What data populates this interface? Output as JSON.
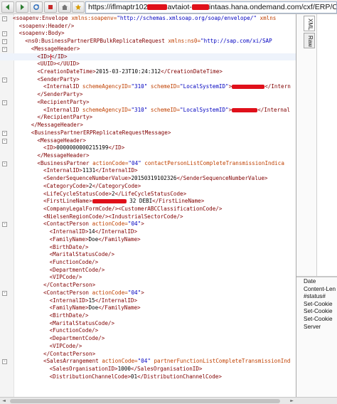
{
  "toolbar": {
    "back_label": "◄",
    "forward_label": "►",
    "url_parts": [
      "https://iflmaptr102",
      "avtaiot-",
      "intaas.hana.ondemand.com/cxf/ERP/COD/customers"
    ]
  },
  "xml_lines": [
    {
      "ind": 0,
      "tog": "-",
      "html": "<span class='tag'>&lt;soapenv:Envelope</span> <span class='aname'>xmlns:soapenv=</span><span class='aval'>\"http://schemas.xmlsoap.org/soap/envelope/\"</span> <span class='aname'>xmlns</span>"
    },
    {
      "ind": 1,
      "tog": "",
      "html": "<span class='tag'>&lt;soapenv:Header/&gt;</span>"
    },
    {
      "ind": 1,
      "tog": "-",
      "html": "<span class='tag'>&lt;soapenv:Body&gt;</span>"
    },
    {
      "ind": 2,
      "tog": "-",
      "html": "<span class='tag'>&lt;ns0:BusinessPartnerERPBulkReplicateRequest</span> <span class='aname'>xmlns:ns0=</span><span class='aval'>\"http://sap.com/xi/SAP</span>"
    },
    {
      "ind": 3,
      "tog": "-",
      "html": "<span class='tag'>&lt;MessageHeader&gt;</span>"
    },
    {
      "ind": 4,
      "tog": "",
      "html": "<span class='tag'>&lt;ID&gt;</span><span class='cursor'></span><span class='tag'>&lt;/ID&gt;</span>"
    },
    {
      "ind": 4,
      "tog": "",
      "html": "<span class='tag'>&lt;UUID&gt;&lt;/UUID&gt;</span>"
    },
    {
      "ind": 4,
      "tog": "",
      "html": "<span class='tag'>&lt;CreationDateTime&gt;</span><span class='txt'>2015-03-23T10:24:312</span><span class='tag'>&lt;/CreationDateTime&gt;</span>"
    },
    {
      "ind": 4,
      "tog": "-",
      "html": "<span class='tag'>&lt;SenderParty&gt;</span>"
    },
    {
      "ind": 5,
      "tog": "",
      "html": "<span class='tag'>&lt;InternalID</span> <span class='aname'>schemeAgencyID=</span><span class='aval'>\"310\"</span> <span class='aname'>schemeID=</span><span class='aval'>\"LocalSystemID\"</span><span class='tag'>&gt;</span><span class='redact' style='width:46px'></span><span class='tag'>&lt;/Intern</span>"
    },
    {
      "ind": 4,
      "tog": "",
      "html": "<span class='tag'>&lt;/SenderParty&gt;</span>"
    },
    {
      "ind": 4,
      "tog": "-",
      "html": "<span class='tag'>&lt;RecipientParty&gt;</span>"
    },
    {
      "ind": 5,
      "tog": "",
      "html": "<span class='tag'>&lt;InternalID</span> <span class='aname'>schemeAgencyID=</span><span class='aval'>\"310\"</span> <span class='aname'>schemeID=</span><span class='aval'>\"LocalSystemID\"</span><span class='tag'>&gt;</span><span class='redact' style='width:36px'></span><span class='tag'>&lt;/Internal</span>"
    },
    {
      "ind": 4,
      "tog": "",
      "html": "<span class='tag'>&lt;/RecipientParty&gt;</span>"
    },
    {
      "ind": 3,
      "tog": "",
      "html": "<span class='tag'>&lt;/MessageHeader&gt;</span>"
    },
    {
      "ind": 3,
      "tog": "-",
      "html": "<span class='tag'>&lt;BusinessPartnerERPReplicateRequestMessage&gt;</span>"
    },
    {
      "ind": 4,
      "tog": "-",
      "html": "<span class='tag'>&lt;MessageHeader&gt;</span>"
    },
    {
      "ind": 5,
      "tog": "",
      "html": "<span class='tag'>&lt;ID&gt;</span><span class='txt'>0000000000215199</span><span class='tag'>&lt;/ID&gt;</span>"
    },
    {
      "ind": 4,
      "tog": "",
      "html": "<span class='tag'>&lt;/MessageHeader&gt;</span>"
    },
    {
      "ind": 4,
      "tog": "-",
      "html": "<span class='tag'>&lt;BusinessPartner</span> <span class='aname'>actionCode=</span><span class='aval'>\"04\"</span> <span class='aname'>contactPersonListCompleteTransmissionIndica</span>"
    },
    {
      "ind": 5,
      "tog": "",
      "html": "<span class='tag'>&lt;InternalID&gt;</span><span class='txt'>1131</span><span class='tag'>&lt;/InternalID&gt;</span>"
    },
    {
      "ind": 5,
      "tog": "",
      "html": "<span class='tag'>&lt;SenderSequenceNumberValue&gt;</span><span class='txt'>20150319102326</span><span class='tag'>&lt;/SenderSequenceNumberValue&gt;</span>"
    },
    {
      "ind": 5,
      "tog": "",
      "html": "<span class='tag'>&lt;CategoryCode&gt;</span><span class='txt'>2</span><span class='tag'>&lt;/CategoryCode&gt;</span>"
    },
    {
      "ind": 5,
      "tog": "",
      "html": "<span class='tag'>&lt;LifeCycleStatusCode&gt;</span><span class='txt'>2</span><span class='tag'>&lt;/LifeCycleStatusCode&gt;</span>"
    },
    {
      "ind": 5,
      "tog": "",
      "html": "<span class='tag'>&lt;FirstLineName&gt;</span><span class='redact' style='width:48px'></span> <span class='txt'>32 DEBI</span><span class='tag'>&lt;/FirstLineName&gt;</span>"
    },
    {
      "ind": 5,
      "tog": "",
      "html": "<span class='tag'>&lt;CompanyLegalFormCode/&gt;&lt;CustomerABCClassificationCode/&gt;</span>"
    },
    {
      "ind": 5,
      "tog": "",
      "html": "<span class='tag'>&lt;NielsenRegionCode/&gt;&lt;IndustrialSectorCode/&gt;</span>"
    },
    {
      "ind": 5,
      "tog": "-",
      "html": "<span class='tag'>&lt;ContactPerson</span> <span class='aname'>actionCode=</span><span class='aval'>\"04\"</span><span class='tag'>&gt;</span>"
    },
    {
      "ind": 6,
      "tog": "",
      "html": "<span class='tag'>&lt;InternalID&gt;</span><span class='txt'>14</span><span class='tag'>&lt;/InternalID&gt;</span>"
    },
    {
      "ind": 6,
      "tog": "",
      "html": "<span class='tag'>&lt;FamilyName&gt;</span><span class='txt'>Doe</span><span class='tag'>&lt;/FamilyName&gt;</span>"
    },
    {
      "ind": 6,
      "tog": "",
      "html": "<span class='tag'>&lt;BirthDate/&gt;</span>"
    },
    {
      "ind": 6,
      "tog": "",
      "html": "<span class='tag'>&lt;MaritalStatusCode/&gt;</span>"
    },
    {
      "ind": 6,
      "tog": "",
      "html": "<span class='tag'>&lt;FunctionCode/&gt;</span>"
    },
    {
      "ind": 6,
      "tog": "",
      "html": "<span class='tag'>&lt;DepartmentCode/&gt;</span>"
    },
    {
      "ind": 6,
      "tog": "",
      "html": "<span class='tag'>&lt;VIPCode/&gt;</span>"
    },
    {
      "ind": 5,
      "tog": "",
      "html": "<span class='tag'>&lt;/ContactPerson&gt;</span>"
    },
    {
      "ind": 5,
      "tog": "-",
      "html": "<span class='tag'>&lt;ContactPerson</span> <span class='aname'>actionCode=</span><span class='aval'>\"04\"</span><span class='tag'>&gt;</span>"
    },
    {
      "ind": 6,
      "tog": "",
      "html": "<span class='tag'>&lt;InternalID&gt;</span><span class='txt'>15</span><span class='tag'>&lt;/InternalID&gt;</span>"
    },
    {
      "ind": 6,
      "tog": "",
      "html": "<span class='tag'>&lt;FamilyName&gt;</span><span class='txt'>Doe</span><span class='tag'>&lt;/FamilyName&gt;</span>"
    },
    {
      "ind": 6,
      "tog": "",
      "html": "<span class='tag'>&lt;BirthDate/&gt;</span>"
    },
    {
      "ind": 6,
      "tog": "",
      "html": "<span class='tag'>&lt;MaritalStatusCode/&gt;</span>"
    },
    {
      "ind": 6,
      "tog": "",
      "html": "<span class='tag'>&lt;FunctionCode/&gt;</span>"
    },
    {
      "ind": 6,
      "tog": "",
      "html": "<span class='tag'>&lt;DepartmentCode/&gt;</span>"
    },
    {
      "ind": 6,
      "tog": "",
      "html": "<span class='tag'>&lt;VIPCode/&gt;</span>"
    },
    {
      "ind": 5,
      "tog": "",
      "html": "<span class='tag'>&lt;/ContactPerson&gt;</span>"
    },
    {
      "ind": 5,
      "tog": "-",
      "html": "<span class='tag'>&lt;SalesArrangement</span> <span class='aname'>actionCode=</span><span class='aval'>\"04\"</span> <span class='aname'>partnerFunctionListCompleteTransmissionInd</span>"
    },
    {
      "ind": 6,
      "tog": "",
      "html": "<span class='tag'>&lt;SalesOrganisationID&gt;</span><span class='txt'>1000</span><span class='tag'>&lt;/SalesOrganisationID&gt;</span>"
    },
    {
      "ind": 6,
      "tog": "",
      "html": "<span class='tag'>&lt;DistributionChannelCode&gt;</span><span class='txt'>01</span><span class='tag'>&lt;/DistributionChannelCode&gt;</span>"
    }
  ],
  "side_tabs": [
    "XML",
    "Raw"
  ],
  "response_headers": [
    "Date",
    "Content-Len",
    "#status#",
    "Set-Cookie",
    "Set-Cookie",
    "Set-Cookie",
    "Server"
  ]
}
